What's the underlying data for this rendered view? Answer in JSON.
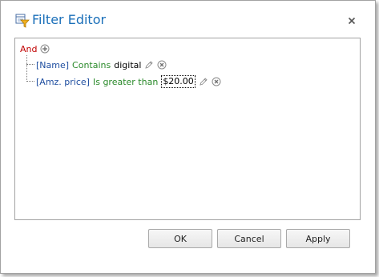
{
  "dialog": {
    "title": "Filter Editor",
    "title_icon": "filter-editor-icon",
    "close_icon": "close-icon"
  },
  "filter": {
    "group_operator": "And",
    "add_icon": "add-condition-icon",
    "conditions": [
      {
        "field": "[Name]",
        "operation": "Contains",
        "value": "digital",
        "edit_icon": "pencil-icon",
        "remove_icon": "remove-condition-icon"
      },
      {
        "field": "[Amz. price]",
        "operation": "Is greater than",
        "value": "$20.00",
        "edit_icon": "pencil-icon",
        "remove_icon": "remove-condition-icon"
      }
    ]
  },
  "buttons": {
    "ok": "OK",
    "cancel": "Cancel",
    "apply": "Apply"
  }
}
